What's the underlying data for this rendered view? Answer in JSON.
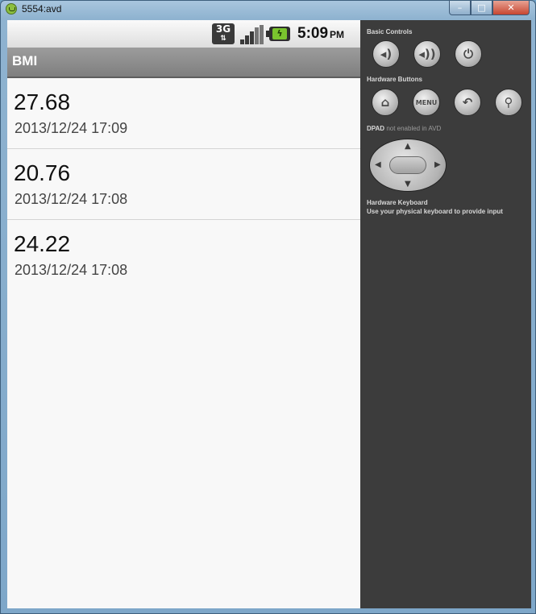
{
  "window": {
    "title": "5554:avd",
    "minimize_glyph": "–",
    "maximize_glyph": "□",
    "close_glyph": "✕"
  },
  "statusbar": {
    "network_label": "3G",
    "time": "5:09",
    "ampm": "PM"
  },
  "app": {
    "title": "BMI"
  },
  "records": [
    {
      "value": "27.68",
      "timestamp": "2013/12/24 17:09"
    },
    {
      "value": "20.76",
      "timestamp": "2013/12/24 17:08"
    },
    {
      "value": "24.22",
      "timestamp": "2013/12/24 17:08"
    }
  ],
  "panel": {
    "basic_controls_label": "Basic Controls",
    "hardware_buttons_label": "Hardware Buttons",
    "menu_button_label": "MENU",
    "dpad_label_prefix": "DPAD",
    "dpad_label_suffix": "not enabled in AVD",
    "keyboard_label": "Hardware Keyboard",
    "keyboard_hint": "Use your physical keyboard to provide input"
  },
  "icons": {
    "app": "android-icon",
    "volume_down": "volume-down-icon",
    "volume_up": "volume-up-icon",
    "power": "power-icon",
    "home": "home-icon",
    "back": "back-icon",
    "search": "search-icon"
  },
  "colors": {
    "panel_bg": "#3c3c3c",
    "screen_bg": "#f8f8f8",
    "actionbar_bg": "#8e8e8e",
    "battery_fill": "#7ac52e"
  }
}
